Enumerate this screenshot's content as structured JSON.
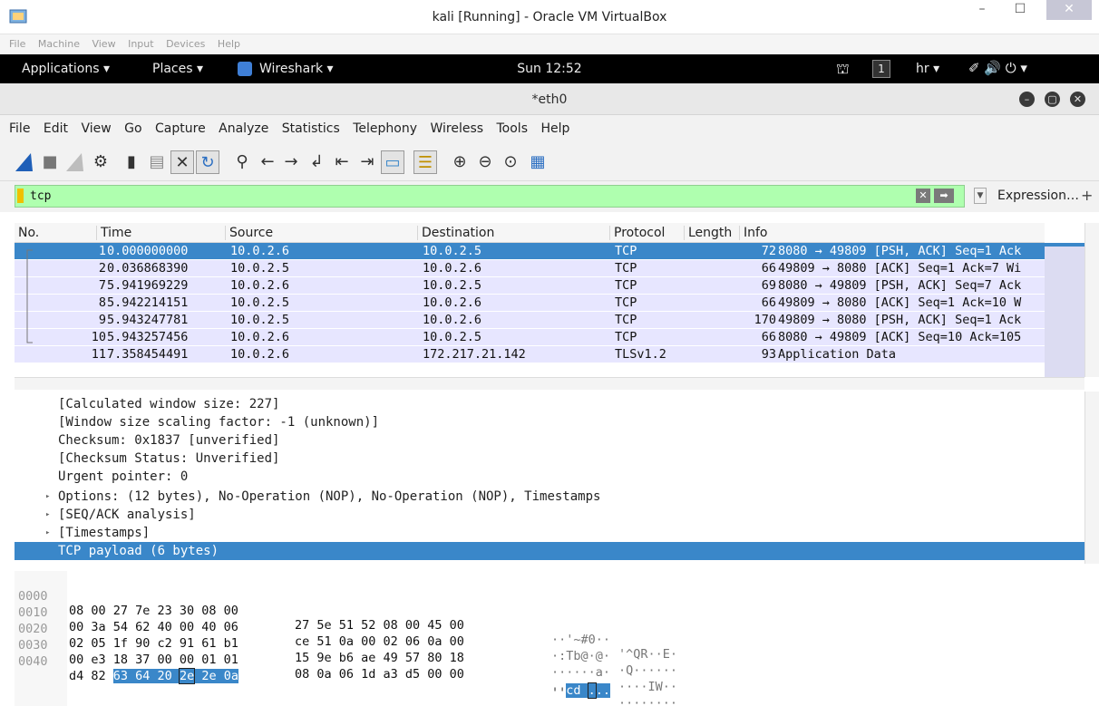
{
  "vbox": {
    "title": "kali [Running] - Oracle VM VirtualBox",
    "menu": [
      "File",
      "Machine",
      "View",
      "Input",
      "Devices",
      "Help"
    ]
  },
  "gnome": {
    "applications": "Applications ▾",
    "places": "Places ▾",
    "wireshark": "Wireshark ▾",
    "clock": "Sun 12:52",
    "workspace": "1",
    "keyboard": "hr ▾"
  },
  "wireshark": {
    "title": "*eth0",
    "menu": [
      "File",
      "Edit",
      "View",
      "Go",
      "Capture",
      "Analyze",
      "Statistics",
      "Telephony",
      "Wireless",
      "Tools",
      "Help"
    ],
    "filter": {
      "value": "tcp",
      "expression_label": "Expression…",
      "plus": "+"
    },
    "columns": {
      "no": "No.",
      "time": "Time",
      "source": "Source",
      "destination": "Destination",
      "protocol": "Protocol",
      "length": "Length",
      "info": "Info"
    },
    "packets": [
      {
        "no": "1",
        "time": "0.000000000",
        "src": "10.0.2.6",
        "dst": "10.0.2.5",
        "proto": "TCP",
        "len": "72",
        "info": "8080 → 49809 [PSH, ACK] Seq=1 Ack"
      },
      {
        "no": "2",
        "time": "0.036868390",
        "src": "10.0.2.5",
        "dst": "10.0.2.6",
        "proto": "TCP",
        "len": "66",
        "info": "49809 → 8080 [ACK] Seq=1 Ack=7 Wi"
      },
      {
        "no": "7",
        "time": "5.941969229",
        "src": "10.0.2.6",
        "dst": "10.0.2.5",
        "proto": "TCP",
        "len": "69",
        "info": "8080 → 49809 [PSH, ACK] Seq=7 Ack"
      },
      {
        "no": "8",
        "time": "5.942214151",
        "src": "10.0.2.5",
        "dst": "10.0.2.6",
        "proto": "TCP",
        "len": "66",
        "info": "49809 → 8080 [ACK] Seq=1 Ack=10 W"
      },
      {
        "no": "9",
        "time": "5.943247781",
        "src": "10.0.2.5",
        "dst": "10.0.2.6",
        "proto": "TCP",
        "len": "170",
        "info": "49809 → 8080 [PSH, ACK] Seq=1 Ack"
      },
      {
        "no": "10",
        "time": "5.943257456",
        "src": "10.0.2.6",
        "dst": "10.0.2.5",
        "proto": "TCP",
        "len": "66",
        "info": "8080 → 49809 [ACK] Seq=10 Ack=105"
      },
      {
        "no": "11",
        "time": "7.358454491",
        "src": "10.0.2.6",
        "dst": "172.217.21.142",
        "proto": "TLSv1.2",
        "len": "93",
        "info": "Application Data"
      }
    ],
    "details": [
      {
        "text": "[Calculated window size: 227]",
        "expander": ""
      },
      {
        "text": "[Window size scaling factor: -1 (unknown)]",
        "expander": ""
      },
      {
        "text": "Checksum: 0x1837 [unverified]",
        "expander": ""
      },
      {
        "text": "[Checksum Status: Unverified]",
        "expander": ""
      },
      {
        "text": "Urgent pointer: 0",
        "expander": ""
      },
      {
        "text": "Options: (12 bytes), No-Operation (NOP), No-Operation (NOP), Timestamps",
        "expander": "▸"
      },
      {
        "text": "[SEQ/ACK analysis]",
        "expander": "▸"
      },
      {
        "text": "[Timestamps]",
        "expander": "▸"
      },
      {
        "text": "TCP payload (6 bytes)",
        "expander": ""
      }
    ],
    "bytes": [
      {
        "off": "0000",
        "hex1": "08 00 27 7e 23 30 08 00",
        "hex2": "27 5e 51 52 08 00 45 00",
        "asc1": "··'~#0··",
        "asc2": "'^QR··E·"
      },
      {
        "off": "0010",
        "hex1": "00 3a 54 62 40 00 40 06",
        "hex2": "ce 51 0a 00 02 06 0a 00",
        "asc1": "·:Tb@·@·",
        "asc2": "·Q······"
      },
      {
        "off": "0020",
        "hex1": "02 05 1f 90 c2 91 61 b1",
        "hex2": "15 9e b6 ae 49 57 80 18",
        "asc1": "······a·",
        "asc2": "····IW··"
      },
      {
        "off": "0030",
        "hex1": "00 e3 18 37 00 00 01 01",
        "hex2": "08 0a 06 1d a3 d5 00 00",
        "asc1": "···7····",
        "asc2": "········"
      }
    ],
    "last_bytes": {
      "off": "0040",
      "hex_plain": "d4 82 ",
      "hex_hl_a": "63 64 20 ",
      "hex_hl_box": "2e",
      "hex_hl_b": " 2e 0a",
      "asc_plain": "··",
      "asc_hl_a": "cd ",
      "asc_hl_box": ".",
      "asc_hl_b": ".."
    }
  }
}
